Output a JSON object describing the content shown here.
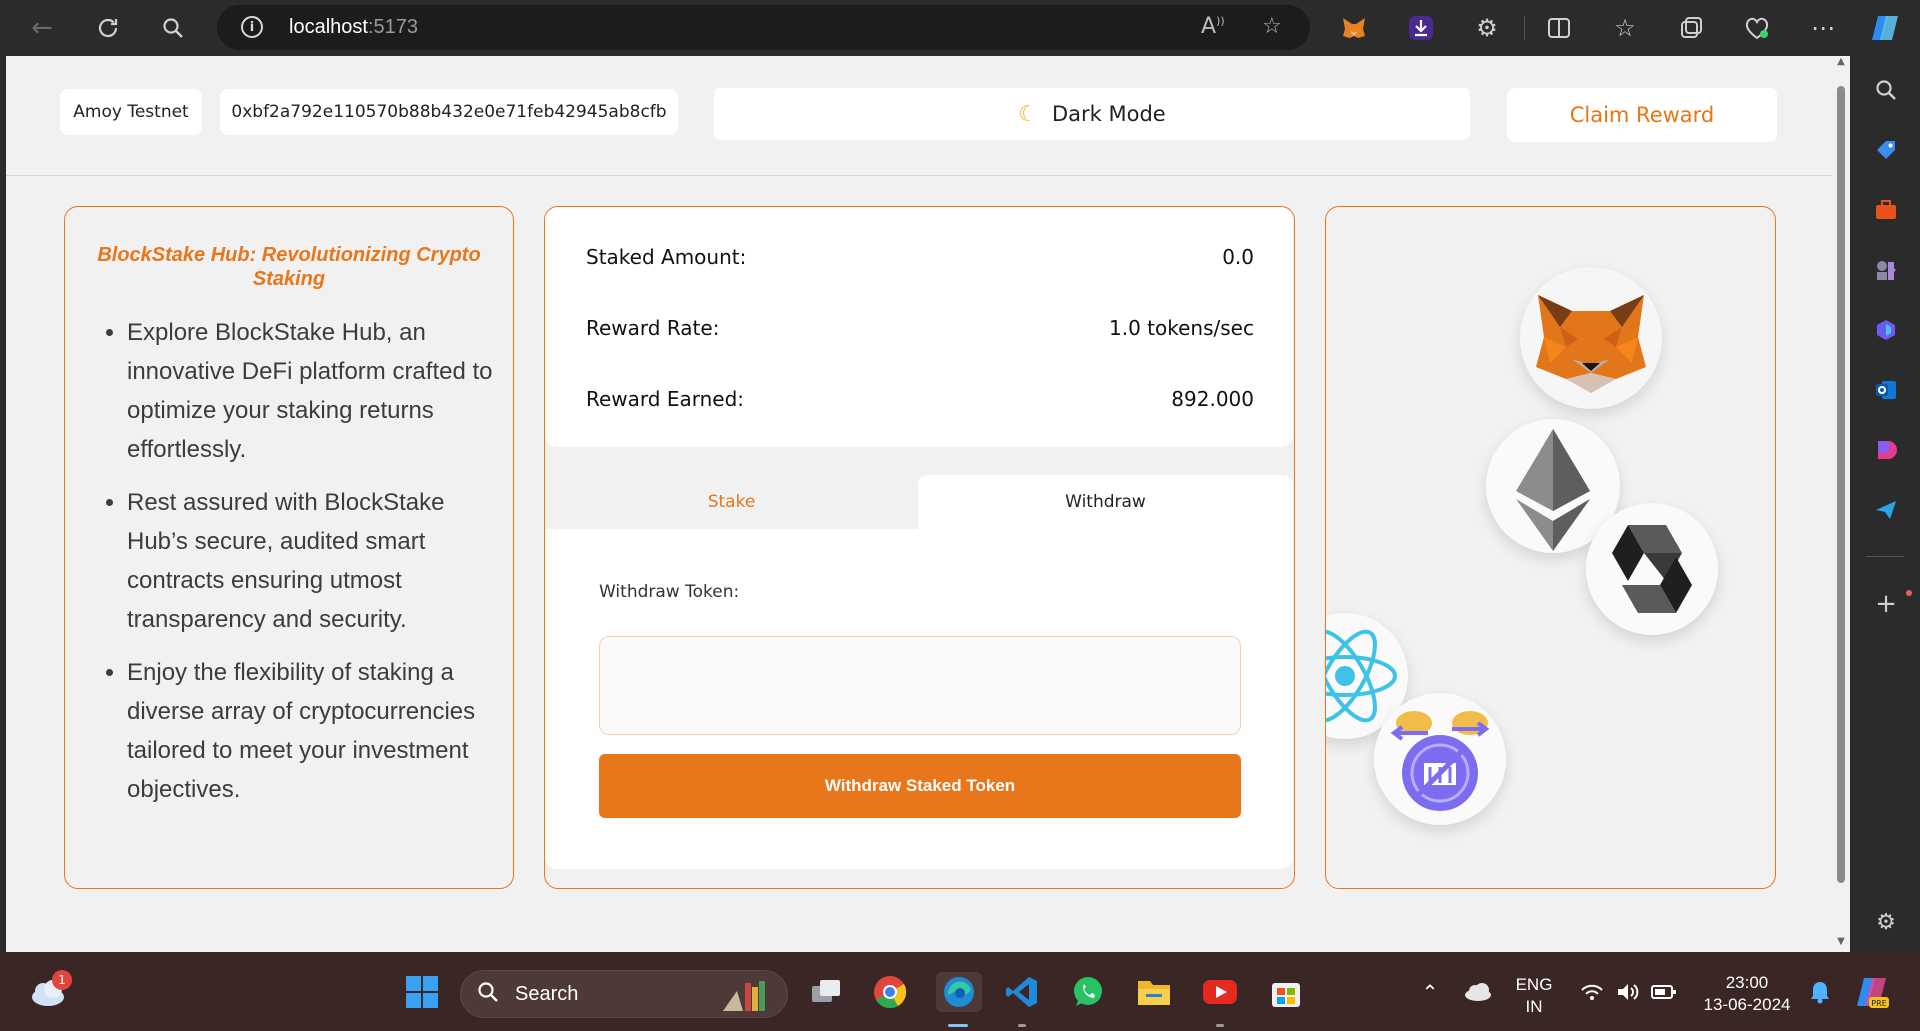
{
  "browser": {
    "url_host": "localhost",
    "url_port": ":5173",
    "read_aloud_label": "Ã"
  },
  "header": {
    "network": "Amoy Testnet",
    "address": "0xbf2a792e110570b88b432e0e71feb42945ab8cfb",
    "dark_mode_label": "Dark Mode",
    "claim_reward_label": "Claim Reward"
  },
  "info": {
    "title": "BlockStake Hub: Revolutionizing Crypto Staking",
    "bullets": [
      "Explore BlockStake Hub, an innovative DeFi platform crafted to optimize your staking returns effortlessly.",
      "Rest assured with BlockStake Hub’s secure, audited smart contracts ensuring utmost transparency and security.",
      "Enjoy the flexibility of staking a diverse array of cryptocurrencies tailored to meet your investment objectives."
    ]
  },
  "stats": {
    "staked_label": "Staked Amount:",
    "staked_value": "0.0",
    "rate_label": "Reward Rate:",
    "rate_value": "1.0 tokens/sec",
    "earned_label": "Reward Earned:",
    "earned_value": "892.000"
  },
  "tabs": {
    "stake": "Stake",
    "withdraw": "Withdraw"
  },
  "withdraw_form": {
    "label": "Withdraw Token:",
    "input_value": "",
    "button": "Withdraw Staked Token"
  },
  "taskbar": {
    "search_label": "Search",
    "weather_badge": "1",
    "lang_line1": "ENG",
    "lang_line2": "IN",
    "time": "23:00",
    "date": "13-06-2024"
  },
  "colors": {
    "accent": "#e8761a",
    "page_bg": "#f1f1f1"
  }
}
